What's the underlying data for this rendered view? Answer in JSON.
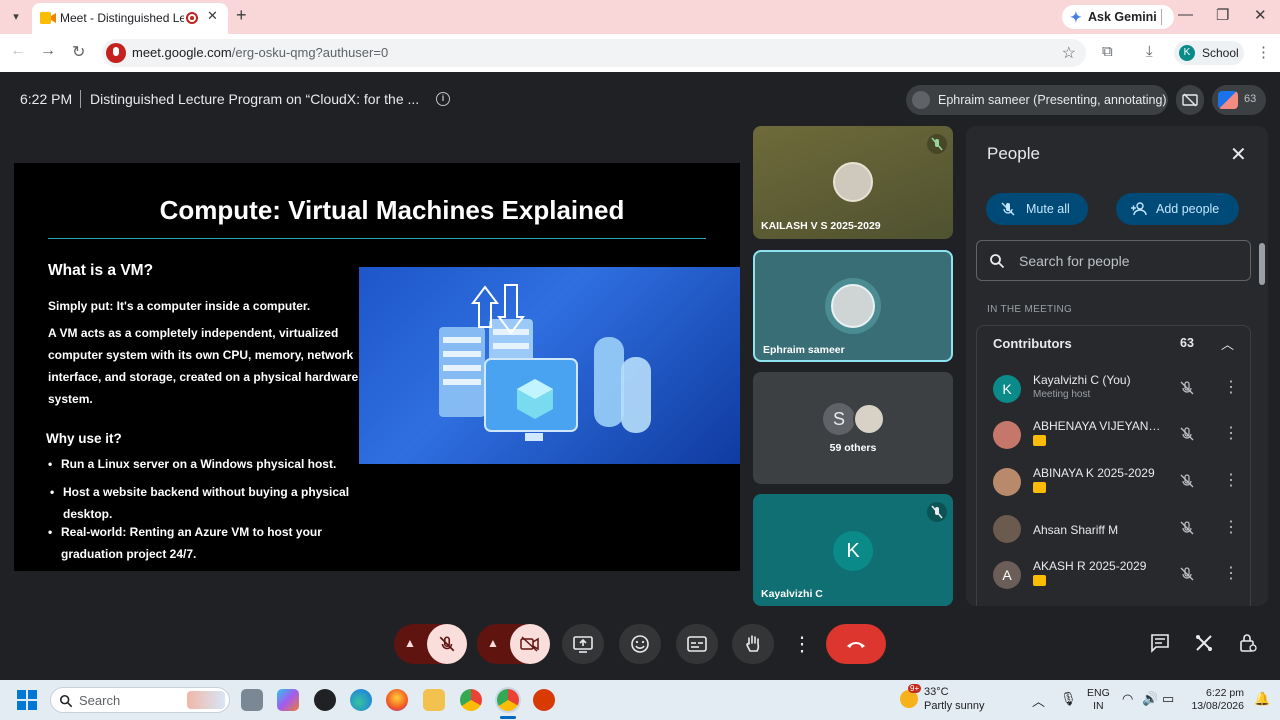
{
  "browser": {
    "tab_title": "Meet - Distinguished Lectu",
    "tab_close": "✕",
    "new_tab": "+",
    "gemini_label": "Ask Gemini",
    "url_main": "meet.google.com",
    "url_path": "/erg-osku-qmg?authuser=0",
    "profile_initial": "K",
    "profile_label": "School"
  },
  "meet_header": {
    "time": "6:22 PM",
    "title": "Distinguished Lecture Program on “CloudX: for the ...",
    "presenter": "Ephraim sameer (Presenting, annotating)",
    "participant_count": "63"
  },
  "slide": {
    "title": "Compute: Virtual Machines Explained",
    "heading1": "What is a VM?",
    "simply": "Simply put: It's a computer inside a computer.",
    "desc_lines": [
      "A VM acts as a completely independent, virtualized",
      "computer system with its own CPU, memory, network",
      "interface, and storage, created on a physical hardware",
      "system."
    ],
    "heading2": "Why use it?",
    "bullets": [
      "Run a Linux server on a Windows physical host.",
      "Host a website backend without buying a physical",
      "desktop.",
      "Real-world: Renting an Azure VM to host your",
      "graduation project 24/7."
    ]
  },
  "tiles": [
    {
      "name": "KAILASH V S 2025-2029"
    },
    {
      "name": "Ephraim sameer"
    },
    {
      "name": "59 others",
      "initial": "S"
    },
    {
      "name": "Kayalvizhi C",
      "initial": "K"
    }
  ],
  "people": {
    "title": "People",
    "mute_all": "Mute all",
    "add_people": "Add people",
    "search_placeholder": "Search for people",
    "section": "IN THE MEETING",
    "group": "Contributors",
    "group_count": "63",
    "list": [
      {
        "name": "Kayalvizhi C (You)",
        "sub": "Meeting host",
        "initial": "K",
        "color": "#0b8a8a"
      },
      {
        "name": "ABHENAYA VIJEYANAN...",
        "initial": "",
        "color": "#c4776a"
      },
      {
        "name": "ABINAYA K 2025-2029",
        "initial": "",
        "color": "#b9896b"
      },
      {
        "name": "Ahsan Shariff M",
        "initial": "",
        "color": "#6b5a4e"
      },
      {
        "name": "AKASH R 2025-2029",
        "initial": "A",
        "color": "#6b5d57"
      }
    ]
  },
  "taskbar": {
    "search": "Search",
    "badge": "9+",
    "temp": "33°C",
    "cond": "Partly sunny",
    "lang1": "ENG",
    "lang2": "IN",
    "time": "6:22 pm",
    "date": "13/08/2026"
  }
}
